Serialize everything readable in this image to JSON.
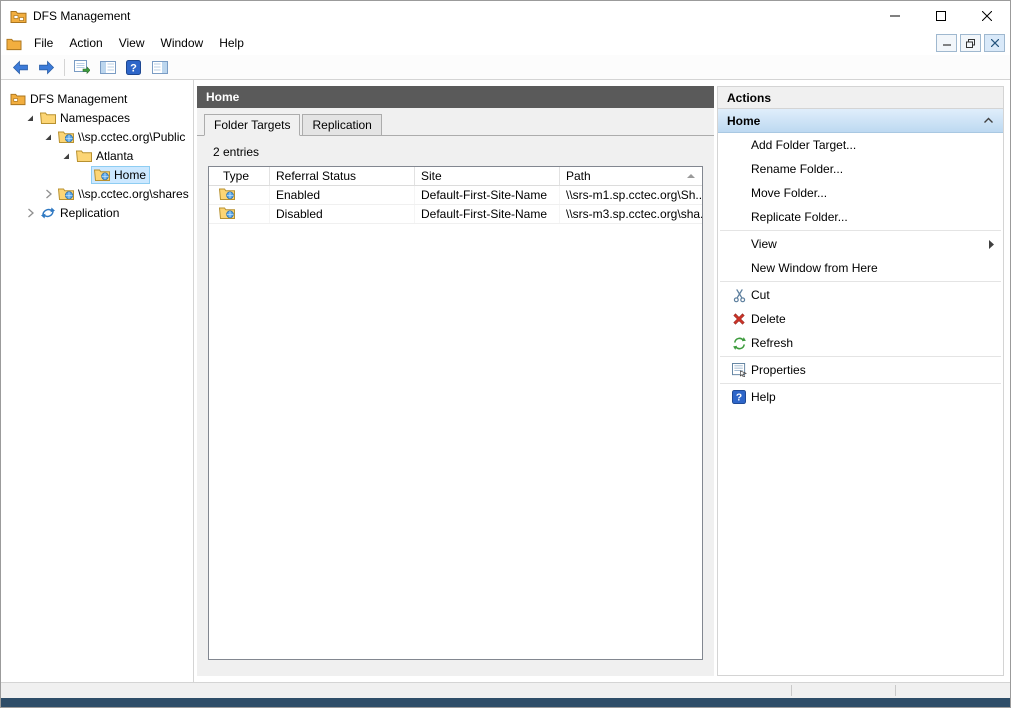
{
  "window": {
    "title": "DFS Management",
    "controls": [
      "minimize-icon",
      "maximize-icon",
      "close-icon"
    ]
  },
  "menubar": {
    "items": [
      "File",
      "Action",
      "View",
      "Window",
      "Help"
    ],
    "mdi_controls": [
      "mdi-minimize-icon",
      "mdi-restore-icon",
      "mdi-close-icon"
    ]
  },
  "toolbar": {
    "icons": [
      "back-icon",
      "forward-icon",
      "export-list-icon",
      "show-console-tree-icon",
      "help-icon",
      "show-action-pane-icon"
    ]
  },
  "tree": {
    "items": [
      {
        "label": "DFS Management",
        "state": "root"
      },
      {
        "label": "Namespaces",
        "state": "expanded"
      },
      {
        "label": "\\\\sp.cctec.org\\Public",
        "state": "expanded"
      },
      {
        "label": "Atlanta",
        "state": "expanded"
      },
      {
        "label": "Home",
        "state": "selected"
      },
      {
        "label": "\\\\sp.cctec.org\\shares",
        "state": "collapsed"
      },
      {
        "label": "Replication",
        "state": "collapsed"
      }
    ]
  },
  "main": {
    "header": "Home",
    "tabs": [
      {
        "label": "Folder Targets",
        "active": true
      },
      {
        "label": "Replication",
        "active": false
      }
    ],
    "entries": "2 entries",
    "table": {
      "columns": [
        "Type",
        "Referral Status",
        "Site",
        "Path"
      ],
      "sorted_column": "Path",
      "sort_direction": "ascending",
      "rows": [
        {
          "referral_status": "Enabled",
          "site": "Default-First-Site-Name",
          "path": "\\\\srs-m1.sp.cctec.org\\Sh..."
        },
        {
          "referral_status": "Disabled",
          "site": "Default-First-Site-Name",
          "path": "\\\\srs-m3.sp.cctec.org\\sha..."
        }
      ]
    }
  },
  "actions": {
    "header": "Actions",
    "section": "Home",
    "items": [
      {
        "label": "Add Folder Target..."
      },
      {
        "label": "Rename Folder..."
      },
      {
        "label": "Move Folder..."
      },
      {
        "label": "Replicate Folder..."
      },
      {
        "label": "View",
        "submenu": true
      },
      {
        "label": "New Window from Here"
      },
      {
        "label": "Cut",
        "icon": "cut-icon"
      },
      {
        "label": "Delete",
        "icon": "delete-icon"
      },
      {
        "label": "Refresh",
        "icon": "refresh-icon"
      },
      {
        "label": "Properties",
        "icon": "properties-icon"
      },
      {
        "label": "Help",
        "icon": "help-icon"
      }
    ]
  }
}
